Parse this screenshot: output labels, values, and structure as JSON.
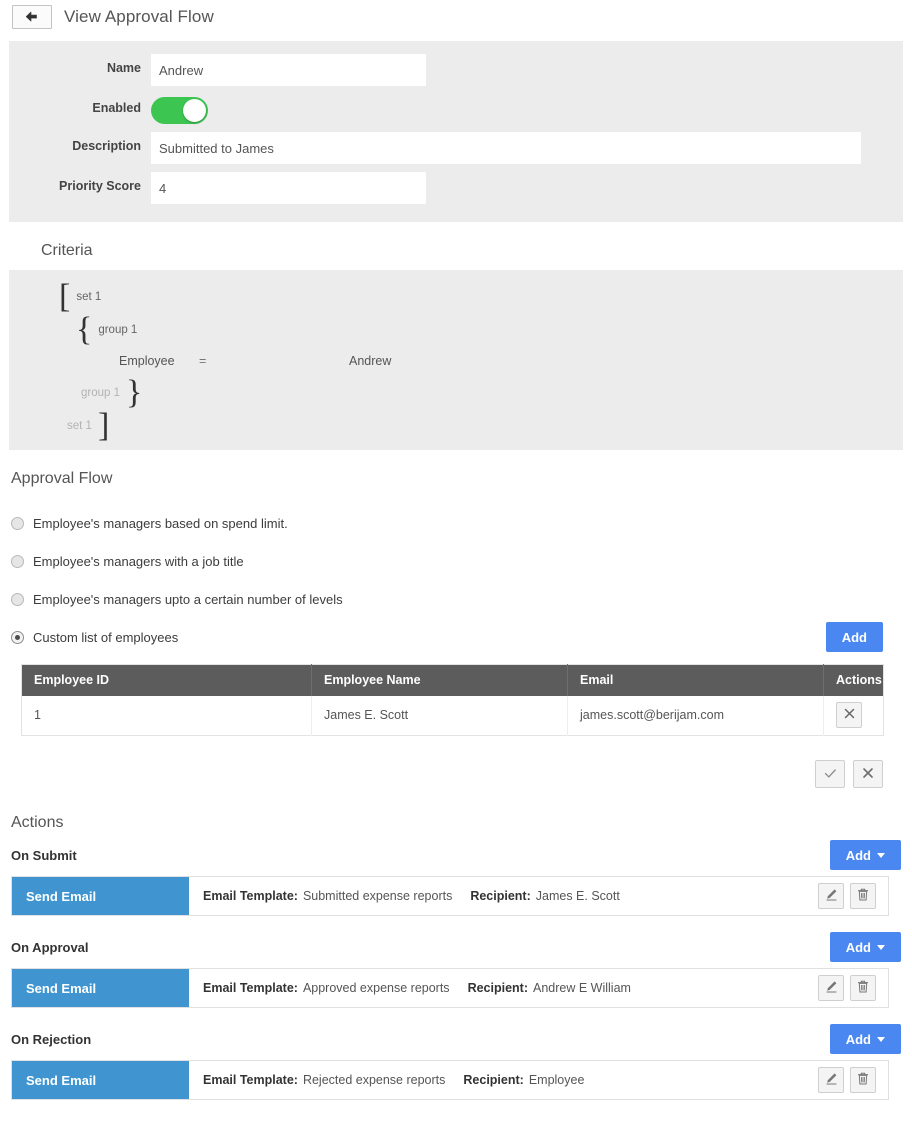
{
  "header": {
    "back_icon": "arrow-left-icon",
    "title": "View Approval Flow"
  },
  "form": {
    "fields": [
      {
        "label": "Name",
        "value": "Andrew"
      },
      {
        "label": "Enabled",
        "value": "on"
      },
      {
        "label": "Description",
        "value": "Submitted to James"
      },
      {
        "label": "Priority Score",
        "value": "4"
      }
    ],
    "toggle_on_color": "#3cc651"
  },
  "criteria": {
    "title": "Criteria",
    "open_set_label": "set 1",
    "open_group_label": "group 1",
    "close_group_label": "group 1",
    "close_set_label": "set 1",
    "rows": [
      {
        "field": "Employee",
        "operator": "=",
        "value": "Andrew"
      }
    ]
  },
  "approval_flow": {
    "title": "Approval Flow",
    "options": [
      {
        "label": "Employee's managers based on spend limit.",
        "selected": false
      },
      {
        "label": "Employee's managers with a job title",
        "selected": false
      },
      {
        "label": "Employee's managers upto a certain number of levels",
        "selected": false
      },
      {
        "label": "Custom list of employees",
        "selected": true
      }
    ],
    "add_label": "Add",
    "table": {
      "columns": [
        "Employee ID",
        "Employee Name",
        "Email",
        "Actions"
      ],
      "rows": [
        {
          "id": "1",
          "name": "James E. Scott",
          "email": "james.scott@berijam.com",
          "action_icon": "close-icon"
        }
      ]
    },
    "confirm_icon": "check-icon",
    "cancel_icon": "close-icon"
  },
  "actions": {
    "title": "Actions",
    "add_label": "Add",
    "groups": [
      {
        "label": "On Submit",
        "card": {
          "type": "Send Email",
          "template_label": "Email Template:",
          "template_value": "Submitted expense reports",
          "recipient_label": "Recipient:",
          "recipient_value": "James E. Scott",
          "edit_icon": "pencil-icon",
          "delete_icon": "trash-icon"
        }
      },
      {
        "label": "On Approval",
        "card": {
          "type": "Send Email",
          "template_label": "Email Template:",
          "template_value": "Approved expense reports",
          "recipient_label": "Recipient:",
          "recipient_value": "Andrew E William",
          "edit_icon": "pencil-icon",
          "delete_icon": "trash-icon"
        }
      },
      {
        "label": "On Rejection",
        "card": {
          "type": "Send Email",
          "template_label": "Email Template:",
          "template_value": "Rejected expense reports",
          "recipient_label": "Recipient:",
          "recipient_value": "Employee",
          "edit_icon": "pencil-icon",
          "delete_icon": "trash-icon"
        }
      }
    ]
  },
  "colors": {
    "accent_blue": "#4a87f0",
    "badge_blue": "#4095d1",
    "panel_gray": "#ececec",
    "table_header_gray": "#5c5c5c",
    "toggle_green": "#3cc651"
  }
}
